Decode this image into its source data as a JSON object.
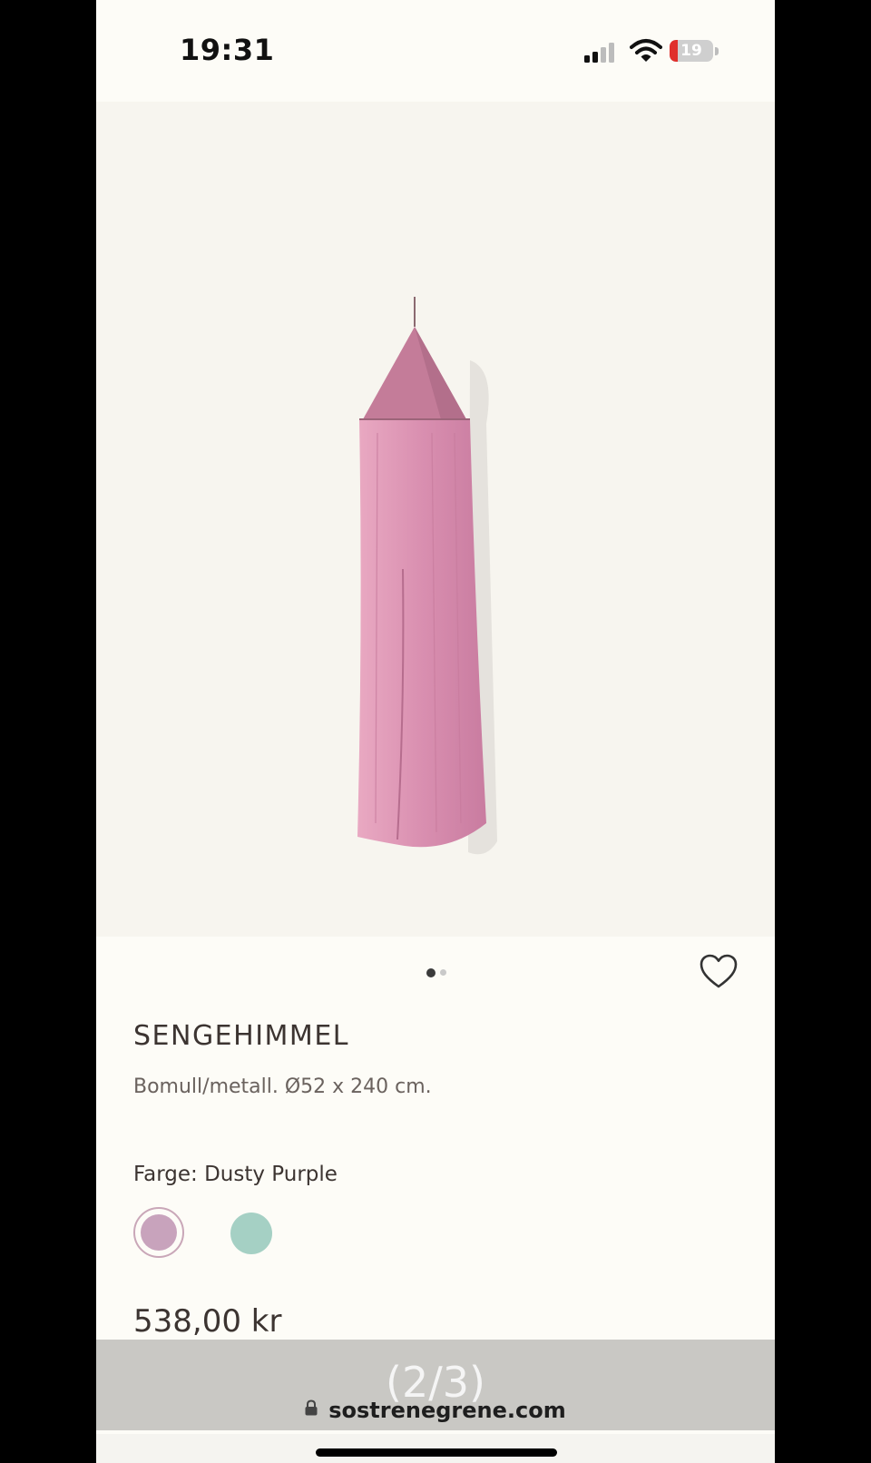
{
  "status_bar": {
    "time": "19:31",
    "battery_level": "19",
    "battery_fraction": 0.19,
    "battery_color": "#e0302c",
    "icons": [
      "cellular-signal-icon",
      "wifi-icon",
      "battery-icon"
    ]
  },
  "product": {
    "title": "SENGEHIMMEL",
    "description": "Bomull/metall. Ø52 x 240 cm.",
    "color_label": "Farge: Dusty Purple",
    "price": "538,00 kr",
    "image_color": "#d98fb0",
    "swatches": [
      {
        "color": "#c8a3bc",
        "selected": true
      },
      {
        "color": "#a5d0c4",
        "selected": false
      }
    ]
  },
  "carousel": {
    "active_index": 1,
    "total_dots": 2
  },
  "overlay": {
    "page_counter": "(2/3)"
  },
  "browser": {
    "url": "sostrenegrene.com"
  }
}
